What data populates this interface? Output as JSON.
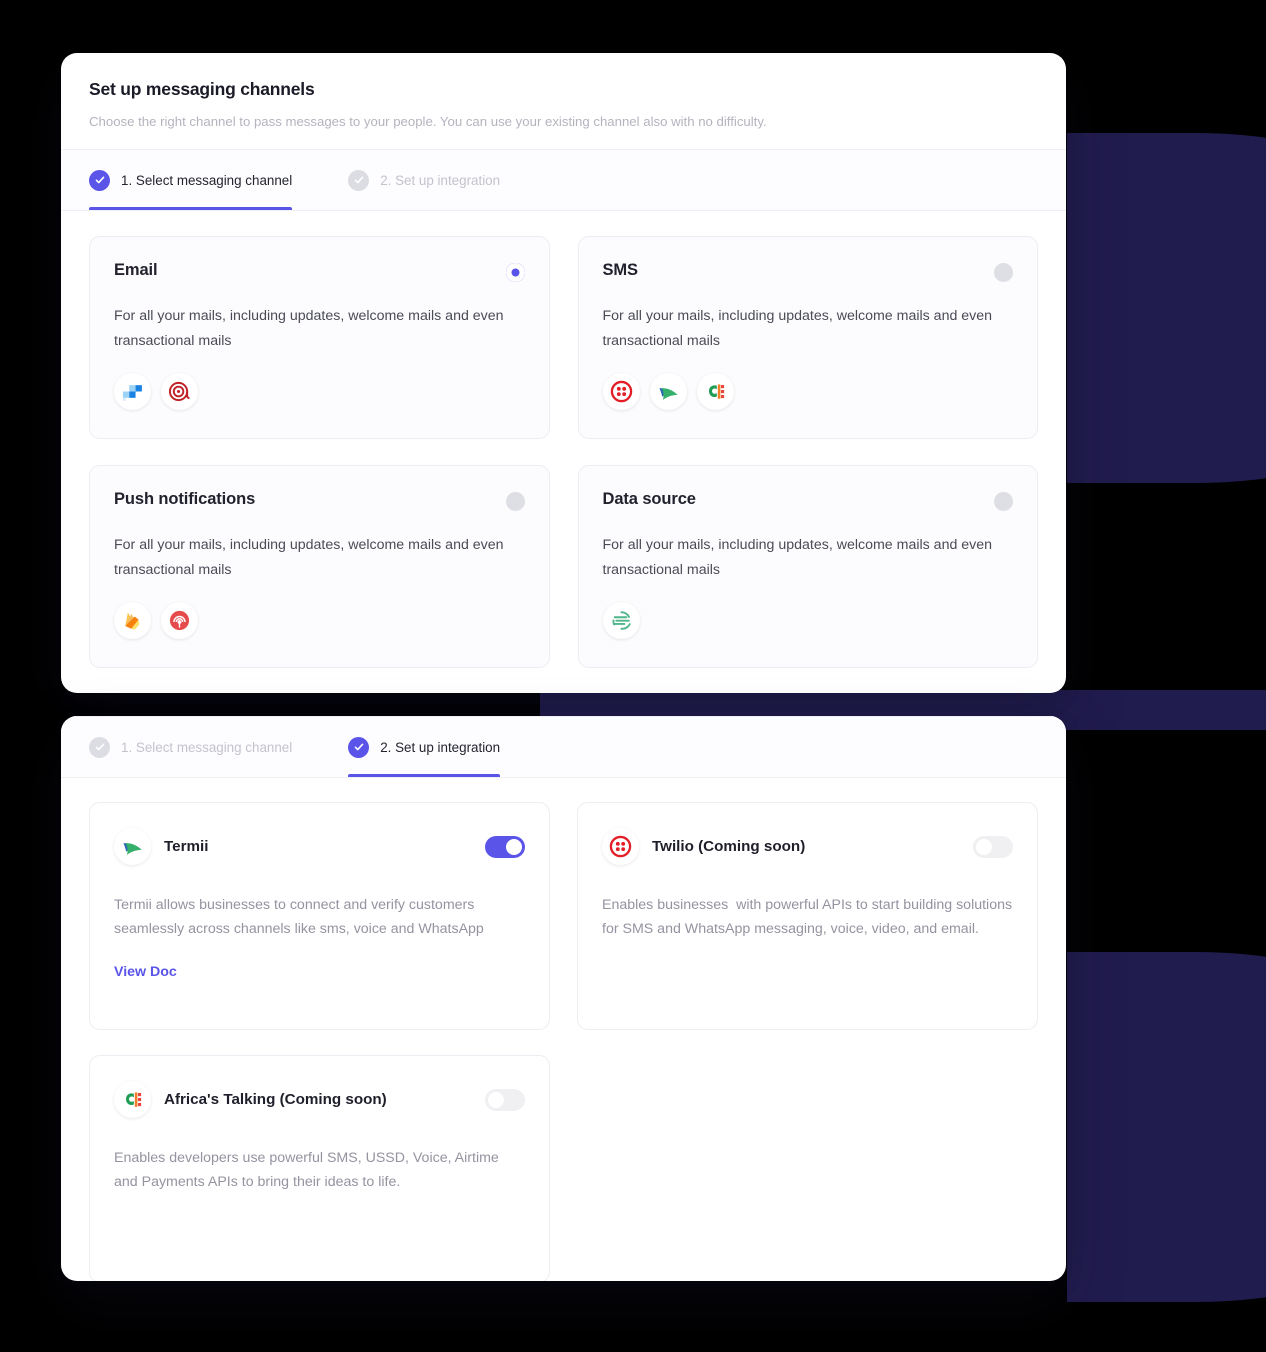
{
  "decor": {
    "blob_color": "#211c4e",
    "accent": "#5a55e8"
  },
  "panel_one": {
    "title": "Set up messaging channels",
    "subtitle": "Choose the right channel to pass messages to your people. You can use your existing channel also with no difficulty.",
    "tabs": [
      {
        "label": "1. Select messaging channel",
        "state": "active"
      },
      {
        "label": "2. Set up integration",
        "state": "inactive"
      }
    ],
    "channels": [
      {
        "name": "Email",
        "description": "For all your mails, including updates, welcome mails and even transactional mails",
        "selected": true,
        "providers": [
          "sendgrid-icon",
          "mailgun-icon"
        ]
      },
      {
        "name": "SMS",
        "description": "For all your mails, including updates, welcome mails and even transactional mails",
        "selected": false,
        "providers": [
          "twilio-icon",
          "termii-icon",
          "africastalking-icon"
        ]
      },
      {
        "name": "Push notifications",
        "description": "For all your mails, including updates, welcome mails and even transactional mails",
        "selected": false,
        "providers": [
          "firebase-icon",
          "onesignal-icon"
        ]
      },
      {
        "name": "Data source",
        "description": "For all your mails, including updates, welcome mails and even transactional mails",
        "selected": false,
        "providers": [
          "segment-icon"
        ]
      }
    ]
  },
  "panel_two": {
    "tabs": [
      {
        "label": "1. Select messaging channel",
        "state": "inactive"
      },
      {
        "label": "2. Set up integration",
        "state": "active"
      }
    ],
    "integrations": [
      {
        "name": "Termii",
        "icon": "termii-icon",
        "description": "Termii allows businesses to connect and verify customers seamlessly across channels like sms, voice and WhatsApp",
        "enabled": true,
        "link_label": "View Doc"
      },
      {
        "name": "Twilio (Coming soon)",
        "icon": "twilio-icon",
        "description": "Enables businesses  with powerful APIs to start building solutions for SMS and WhatsApp messaging, voice, video, and email.",
        "enabled": false,
        "link_label": null
      },
      {
        "name": "Africa's Talking (Coming soon)",
        "icon": "africastalking-icon",
        "description": "Enables developers use powerful SMS, USSD, Voice, Airtime and Payments APIs to bring their ideas to life.",
        "enabled": false,
        "link_label": null
      }
    ]
  }
}
